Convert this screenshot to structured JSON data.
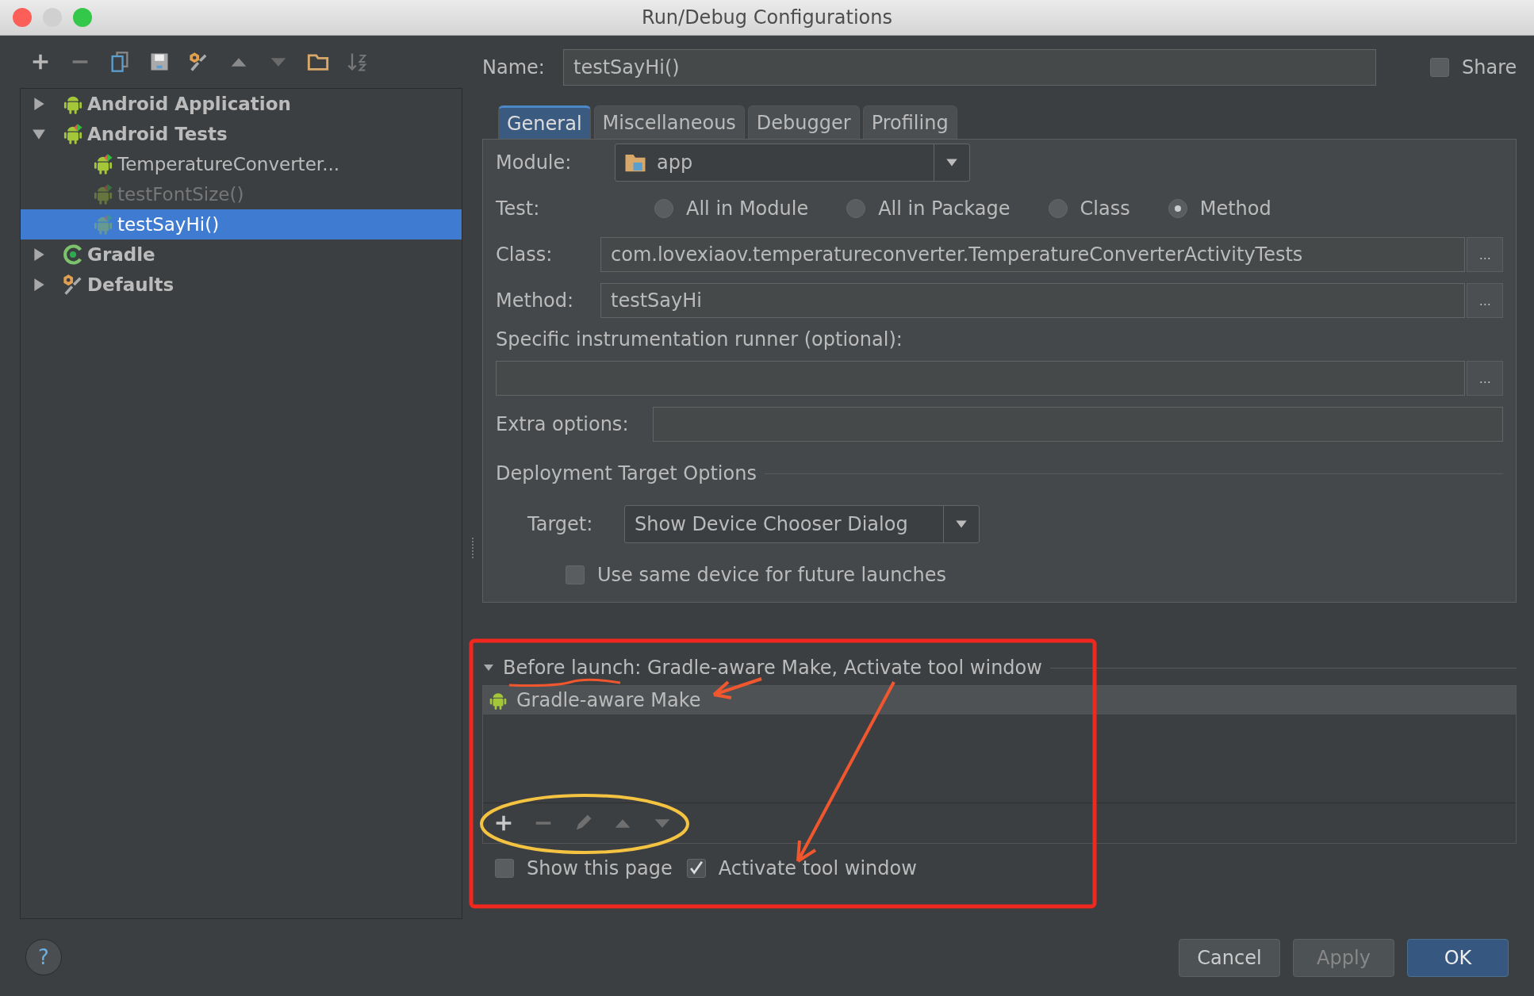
{
  "window": {
    "title": "Run/Debug Configurations"
  },
  "tree": [
    {
      "label": "Android Application",
      "kind": "android",
      "expanded": false,
      "selected": false
    },
    {
      "label": "Android Tests",
      "kind": "android-test",
      "expanded": true,
      "selected": false,
      "children": [
        {
          "label": "TemperatureConverter...",
          "kind": "android-test",
          "selected": false,
          "disabled": false
        },
        {
          "label": "testFontSize()",
          "kind": "android-test",
          "selected": false,
          "disabled": true
        },
        {
          "label": "testSayHi()",
          "kind": "android-test",
          "selected": true,
          "disabled": false
        }
      ]
    },
    {
      "label": "Gradle",
      "kind": "gradle",
      "expanded": false,
      "selected": false
    },
    {
      "label": "Defaults",
      "kind": "defaults",
      "expanded": false,
      "selected": false
    }
  ],
  "name_field": {
    "label": "Name:",
    "value": "testSayHi()"
  },
  "share": {
    "label": "Share",
    "checked": false
  },
  "tabs": [
    {
      "label": "General",
      "selected": true
    },
    {
      "label": "Miscellaneous",
      "selected": false
    },
    {
      "label": "Debugger",
      "selected": false
    },
    {
      "label": "Profiling",
      "selected": false
    }
  ],
  "module": {
    "label": "Module:",
    "value": "app"
  },
  "test": {
    "label": "Test:",
    "options": [
      {
        "label": "All in Module",
        "selected": false
      },
      {
        "label": "All in Package",
        "selected": false
      },
      {
        "label": "Class",
        "selected": false
      },
      {
        "label": "Method",
        "selected": true
      }
    ]
  },
  "fields": [
    {
      "label": "Class:",
      "value": "com.lovexiaov.temperatureconverter.TemperatureConverterActivityTests",
      "browse": "...",
      "kind": "inline"
    },
    {
      "label": "Method:",
      "value": "testSayHi",
      "browse": "...",
      "kind": "inline"
    },
    {
      "label": "Specific instrumentation runner (optional):",
      "browse": "...",
      "kind": "stacked"
    },
    {
      "label": "Extra options:",
      "kind": "wide"
    }
  ],
  "deployment": {
    "heading": "Deployment Target Options",
    "target": {
      "label": "Target:",
      "value": "Show Device Chooser Dialog"
    },
    "same_device": {
      "label": "Use same device for future launches",
      "checked": false
    }
  },
  "before_launch": {
    "heading": "Before launch: Gradle-aware Make, Activate tool window",
    "expanded": true,
    "tasks": [
      {
        "label": "Gradle-aware Make",
        "selected": true
      }
    ]
  },
  "show_page": {
    "label": "Show this page",
    "checked": false
  },
  "activate": {
    "label": "Activate tool window",
    "checked": true
  },
  "help": "?",
  "buttons": [
    {
      "label": "Cancel",
      "kind": "normal"
    },
    {
      "label": "Apply",
      "kind": "disabled"
    },
    {
      "label": "OK",
      "kind": "default"
    }
  ]
}
